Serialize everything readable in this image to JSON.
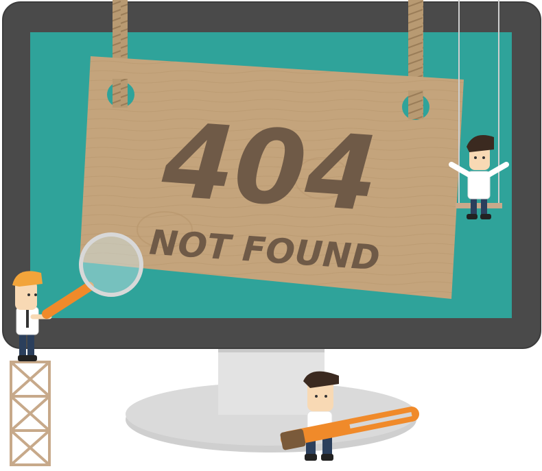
{
  "sign": {
    "code": "404",
    "message": "NOT FOUND"
  },
  "colors": {
    "monitor_bezel": "#4a4a4a",
    "screen": "#2fa39a",
    "stand": "#d9d9d9",
    "wood": "#c4a47c",
    "wood_text": "#6f5a47",
    "rope": "#b89a72",
    "accent_orange": "#f08a2a"
  },
  "illustration": {
    "characters": [
      "man-with-magnifier",
      "man-on-swing",
      "man-with-screwdriver"
    ],
    "props": [
      "magnifying-glass",
      "swing",
      "screwdriver",
      "scaffold-tower",
      "hanging-wood-sign"
    ]
  }
}
